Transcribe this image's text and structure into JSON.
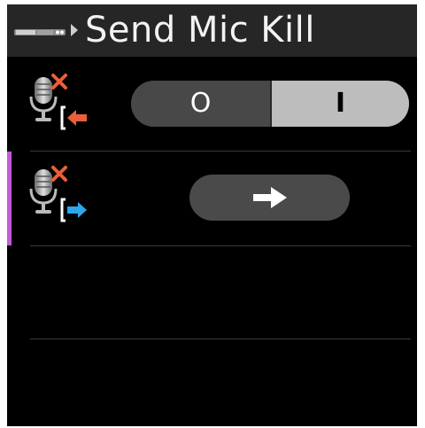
{
  "header": {
    "title": "Send Mic Kill",
    "device_icon": "device-strip-icon",
    "breadcrumb_arrow": "chevron-right-icon"
  },
  "rows": [
    {
      "icon": "mic-kill-receive-icon",
      "control": {
        "type": "toggle",
        "off_label": "O",
        "on_label": "I",
        "selected": "I"
      }
    },
    {
      "icon": "mic-kill-send-icon",
      "control": {
        "type": "button",
        "icon": "arrow-right-icon"
      },
      "selected": true
    },
    {
      "empty": true
    }
  ],
  "colors": {
    "accent": "#c45bd6",
    "receive_arrow": "#e8603a",
    "send_arrow": "#2ea6ea",
    "x_mark": "#e8603a"
  }
}
